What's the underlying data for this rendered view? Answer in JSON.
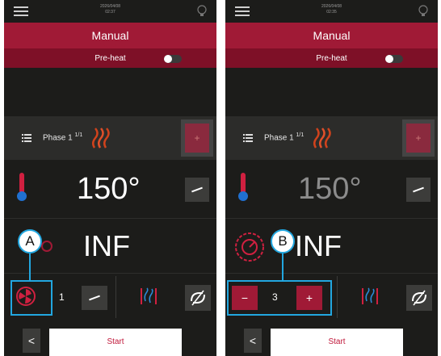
{
  "screens": [
    {
      "status": {
        "date": "2026/04/08",
        "time": "02:37"
      },
      "mode": {
        "title": "Manual",
        "preheat_label": "Pre-heat",
        "preheat_on": false
      },
      "phase": {
        "label": "Phase 1",
        "count": "1/1",
        "add_label": "+"
      },
      "temperature": {
        "value": "150°"
      },
      "duration": {
        "value": "INF"
      },
      "fan": {
        "speed": "1"
      },
      "footer": {
        "back_label": "<",
        "start_label": "Start"
      },
      "callout": {
        "label": "A"
      }
    },
    {
      "status": {
        "date": "2026/04/08",
        "time": "02:35"
      },
      "mode": {
        "title": "Manual",
        "preheat_label": "Pre-heat",
        "preheat_on": false
      },
      "phase": {
        "label": "Phase 1",
        "count": "1/1",
        "add_label": "+"
      },
      "temperature": {
        "value": "150°"
      },
      "duration": {
        "value": "INF"
      },
      "fan": {
        "speed": "3",
        "minus_label": "−",
        "plus_label": "+"
      },
      "footer": {
        "back_label": "<",
        "start_label": "Start"
      },
      "callout": {
        "label": "B"
      }
    }
  ],
  "colors": {
    "accent": "#a01a36",
    "callout": "#22a7e0",
    "background": "#1c1c1a"
  },
  "icons": [
    "menu-icon",
    "lightbulb-icon",
    "list-icon",
    "heat-icon",
    "thermometer-icon",
    "edit-icon",
    "timer-icon",
    "fan-icon",
    "humidity-icon",
    "reverse-icon"
  ]
}
